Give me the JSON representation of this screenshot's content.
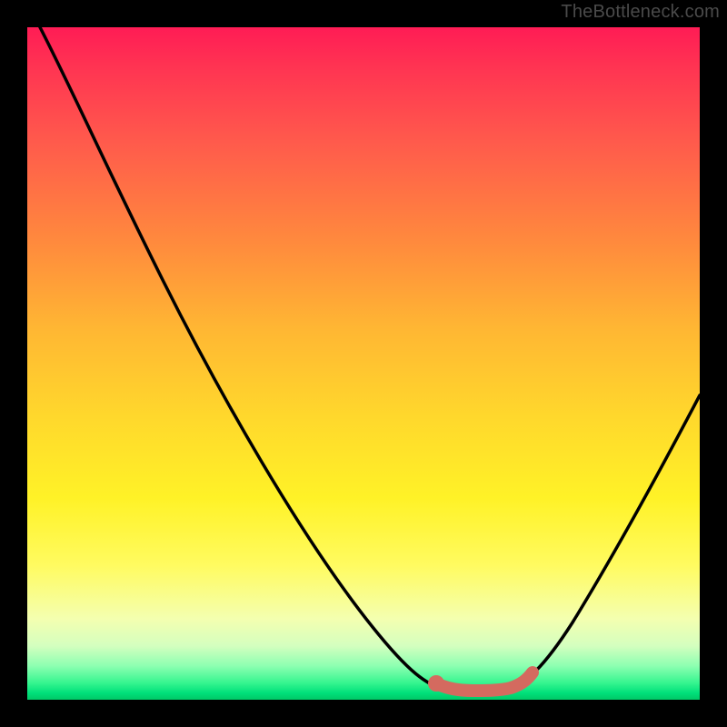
{
  "watermark": "TheBottleneck.com",
  "chart_data": {
    "type": "line",
    "title": "",
    "xlabel": "",
    "ylabel": "",
    "xlim": [
      0,
      100
    ],
    "ylim": [
      0,
      100
    ],
    "curve": {
      "name": "bottleneck-curve",
      "color": "#000000",
      "points": [
        {
          "x": 2,
          "y": 100
        },
        {
          "x": 14,
          "y": 80
        },
        {
          "x": 25,
          "y": 57
        },
        {
          "x": 36,
          "y": 35
        },
        {
          "x": 47,
          "y": 14
        },
        {
          "x": 55,
          "y": 4
        },
        {
          "x": 60,
          "y": 1.5
        },
        {
          "x": 63,
          "y": 1.0
        },
        {
          "x": 71,
          "y": 1.0
        },
        {
          "x": 74,
          "y": 1.7
        },
        {
          "x": 79,
          "y": 6
        },
        {
          "x": 86,
          "y": 17
        },
        {
          "x": 93,
          "y": 30
        },
        {
          "x": 100,
          "y": 45
        }
      ]
    },
    "highlight": {
      "name": "optimal-range",
      "color": "#d46a5f",
      "points": [
        {
          "x": 60,
          "y": 2.2
        },
        {
          "x": 63,
          "y": 1.0
        },
        {
          "x": 67,
          "y": 0.9
        },
        {
          "x": 71,
          "y": 1.2
        },
        {
          "x": 74,
          "y": 2.3
        }
      ],
      "start_dot": {
        "x": 60,
        "y": 2.2
      }
    },
    "gradient_stops": [
      {
        "pos": 0,
        "color": "#ff1c55"
      },
      {
        "pos": 45,
        "color": "#ffb733"
      },
      {
        "pos": 70,
        "color": "#fff227"
      },
      {
        "pos": 100,
        "color": "#00c866"
      }
    ]
  }
}
